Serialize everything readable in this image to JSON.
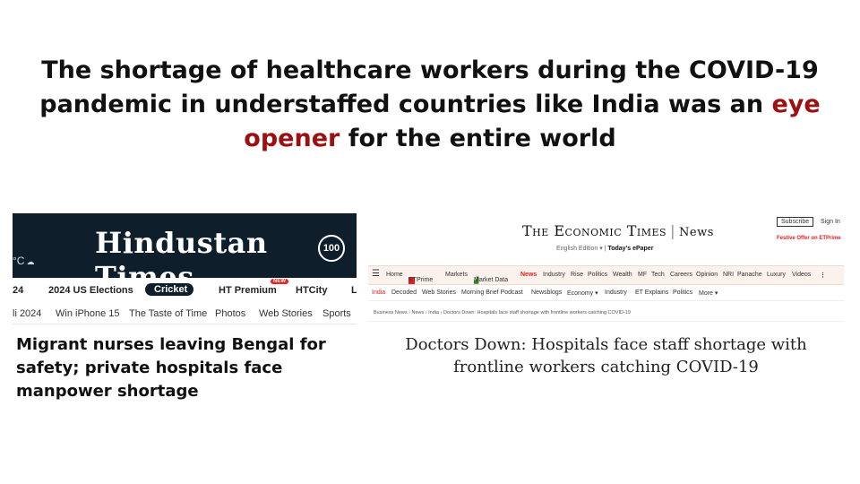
{
  "slide": {
    "title_before": "The shortage of healthcare workers during the COVID-19 pandemic in understaffed countries like India was an ",
    "title_accent": "eye opener",
    "title_after": " for the entire world",
    "accent_color": "#9b1111"
  },
  "ht": {
    "weather": "°C",
    "logo": "Hindustan Times",
    "badge": "100",
    "nav_primary": [
      "24",
      "2024 US Elections",
      "Cricket",
      "HT Premium",
      "HTCity",
      "L"
    ],
    "new_badge": "NEW",
    "nav_secondary": [
      "li 2024",
      "Win iPhone 15",
      "The Taste of Time",
      "Photos",
      "Web Stories",
      "Sports"
    ],
    "headline": "Migrant nurses leaving Bengal for safety; private hospitals face manpower shortage",
    "brand_color": "#0f1e2b"
  },
  "et": {
    "logo": "The Economic Times",
    "logo_section": "News",
    "edition": "English Edition ▾",
    "epaper": "Today's ePaper",
    "subscribe": "Subscribe",
    "signin": "Sign In",
    "festive": "Festive Offer on ETPrime",
    "nav": [
      "Home",
      "ETPrime",
      "Markets",
      "Market Data",
      "News",
      "Industry",
      "Rise",
      "Politics",
      "Wealth",
      "MF",
      "Tech",
      "Careers",
      "Opinion",
      "NRI",
      "Panache",
      "Luxury",
      "Videos"
    ],
    "subnav": [
      "India",
      "Decoded",
      "Web Stories",
      "Morning Brief Podcast",
      "Newsblogs",
      "Economy ▾",
      "Industry",
      "ET Explains",
      "Politics",
      "More ▾"
    ],
    "breadcrumb": "Business News › News › India › Doctors Down: Hospitals face staff shortage with frontline workers catching COVID-19",
    "headline": "Doctors Down: Hospitals face staff shortage with frontline workers catching COVID-19",
    "accent_color": "#dd2222"
  }
}
